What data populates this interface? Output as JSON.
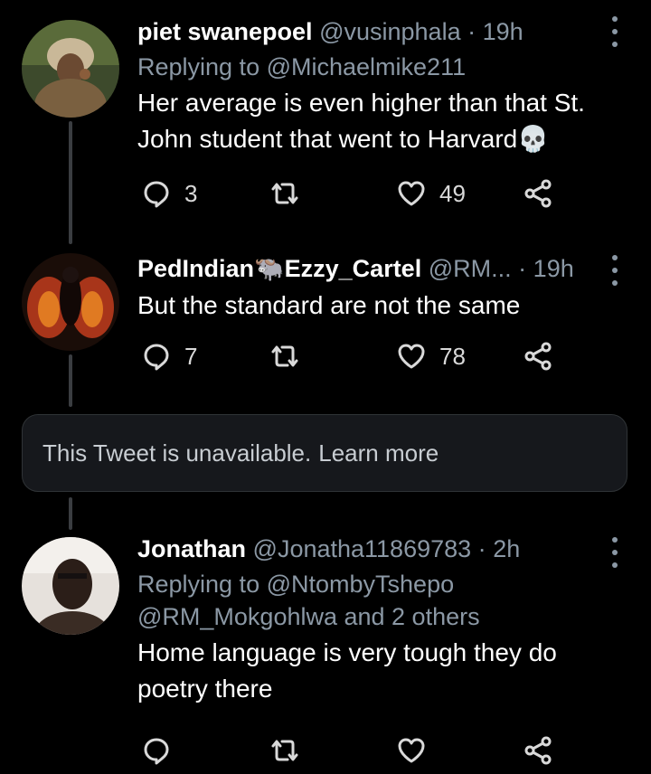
{
  "tweets": [
    {
      "name": "piet swanepoel",
      "handle": "@vusinphala",
      "time": "19h",
      "reply_prefix": "Replying to",
      "reply_to": "@Michaelmike211",
      "text": "Her average is even higher than that St. John student that went to Harvard💀",
      "replies": "3",
      "retweets": "",
      "likes": "49"
    },
    {
      "name": "PedIndian🐃Ezzy_Cartel",
      "handle": "@RM...",
      "time": "19h",
      "text": "But the standard are not the same",
      "replies": "7",
      "retweets": "",
      "likes": "78"
    },
    {
      "name": "Jonathan",
      "handle": "@Jonatha11869783",
      "time": "2h",
      "reply_prefix": "Replying to",
      "reply_to": "@NtombyTshepo",
      "reply_more": "@RM_Mokgohlwa and 2 others",
      "text": "Home language is very tough they do poetry there",
      "replies": "",
      "retweets": "",
      "likes": ""
    }
  ],
  "unavailable": {
    "text": "This Tweet is unavailable.",
    "link": "Learn more"
  },
  "separator": "·",
  "colors": {
    "background": "#000000",
    "muted": "#8b98a5",
    "card": "#16181c"
  },
  "icons": [
    "more-icon",
    "reply-icon",
    "retweet-icon",
    "like-icon",
    "share-icon"
  ]
}
